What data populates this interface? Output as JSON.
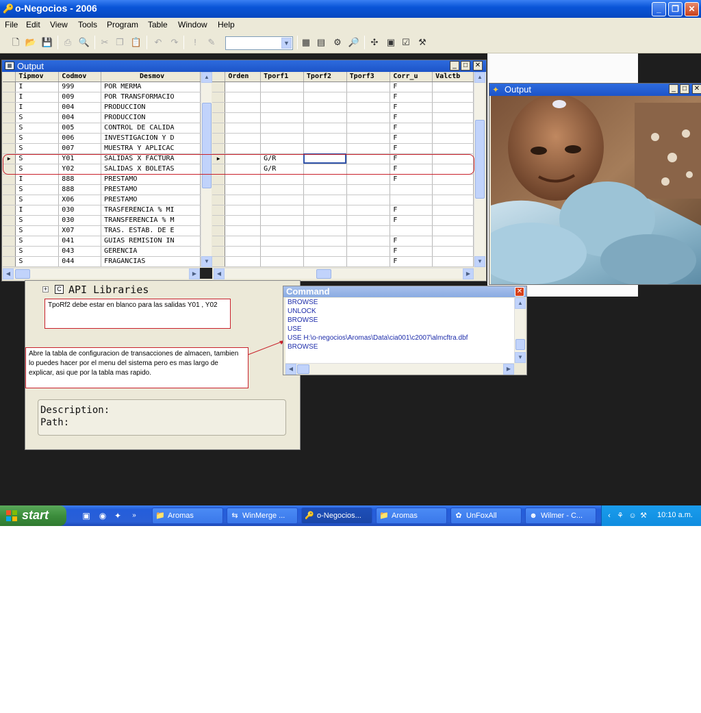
{
  "window": {
    "title": "o-Negocios - 2006"
  },
  "menu": [
    "File",
    "Edit",
    "View",
    "Tools",
    "Program",
    "Table",
    "Window",
    "Help"
  ],
  "grid_window": {
    "title": "Output",
    "left_columns": [
      "Tipmov",
      "Codmov",
      "Desmov"
    ],
    "right_columns": [
      "Orden",
      "Tporf1",
      "Tporf2",
      "Tporf3",
      "Corr_u",
      "Valctb"
    ],
    "rows": [
      {
        "tipmov": "I",
        "codmov": "999",
        "desmov": "POR MERMA",
        "tporf1": "",
        "corr_u": "F"
      },
      {
        "tipmov": "I",
        "codmov": "009",
        "desmov": "POR TRANSFORMACIO",
        "tporf1": "",
        "corr_u": "F"
      },
      {
        "tipmov": "I",
        "codmov": "004",
        "desmov": "PRODUCCION",
        "tporf1": "",
        "corr_u": "F"
      },
      {
        "tipmov": "S",
        "codmov": "004",
        "desmov": "PRODUCCION",
        "tporf1": "",
        "corr_u": "F"
      },
      {
        "tipmov": "S",
        "codmov": "005",
        "desmov": "CONTROL DE CALIDA",
        "tporf1": "",
        "corr_u": "F"
      },
      {
        "tipmov": "S",
        "codmov": "006",
        "desmov": "INVESTIGACION Y D",
        "tporf1": "",
        "corr_u": "F"
      },
      {
        "tipmov": "S",
        "codmov": "007",
        "desmov": "MUESTRA Y APLICAC",
        "tporf1": "",
        "corr_u": "F"
      },
      {
        "tipmov": "S",
        "codmov": "Y01",
        "desmov": "SALIDAS X FACTURA",
        "tporf1": "G/R",
        "corr_u": "F"
      },
      {
        "tipmov": "S",
        "codmov": "Y02",
        "desmov": "SALIDAS X BOLETAS",
        "tporf1": "G/R",
        "corr_u": "F"
      },
      {
        "tipmov": "I",
        "codmov": "888",
        "desmov": "PRESTAMO",
        "tporf1": "",
        "corr_u": "F"
      },
      {
        "tipmov": "S",
        "codmov": "888",
        "desmov": "PRESTAMO",
        "tporf1": "",
        "corr_u": ""
      },
      {
        "tipmov": "S",
        "codmov": "X06",
        "desmov": "PRESTAMO",
        "tporf1": "",
        "corr_u": ""
      },
      {
        "tipmov": "I",
        "codmov": "030",
        "desmov": "TRASFERENCIA % MI",
        "tporf1": "",
        "corr_u": "F"
      },
      {
        "tipmov": "S",
        "codmov": "030",
        "desmov": "TRANSFERENCIA % M",
        "tporf1": "",
        "corr_u": "F"
      },
      {
        "tipmov": "S",
        "codmov": "X07",
        "desmov": "TRAS. ESTAB. DE E",
        "tporf1": "",
        "corr_u": ""
      },
      {
        "tipmov": "S",
        "codmov": "041",
        "desmov": "GUIAS REMISION IN",
        "tporf1": "",
        "corr_u": "F"
      },
      {
        "tipmov": "S",
        "codmov": "043",
        "desmov": "GERENCIA",
        "tporf1": "",
        "corr_u": "F"
      },
      {
        "tipmov": "S",
        "codmov": "044",
        "desmov": "FRAGANCIAS",
        "tporf1": "",
        "corr_u": "F"
      }
    ]
  },
  "photo_window": {
    "title": "Output"
  },
  "api": {
    "label": "API Libraries",
    "description_label": "Description:",
    "path_label": "Path:"
  },
  "notes": {
    "note1": "TpoRf2 debe estar en blanco para las salidas Y01 , Y02",
    "note2": "Abre la tabla de configuracion de transacciones de almacen, tambien lo puedes hacer por el menu del sistema pero es mas largo de explicar, asi que por la tabla mas rapido."
  },
  "command_window": {
    "title": "Command",
    "lines": [
      "BROWSE",
      "UNLOCK",
      "BROWSE",
      "USE",
      "USE  H:\\o-negocios\\Aromas\\Data\\cia001\\c2007\\almcftra.dbf",
      "BROWSE"
    ]
  },
  "taskbar": {
    "start": "start",
    "tasks": [
      "Aromas",
      "WinMerge ...",
      "o-Negocios...",
      "Aromas",
      "UnFoxAll",
      "Wilmer - C..."
    ],
    "clock": "10:10 a.m."
  },
  "colors": {
    "accent": "#0a55d8",
    "note_border": "#c8202a",
    "start_green": "#3c8d3c"
  }
}
